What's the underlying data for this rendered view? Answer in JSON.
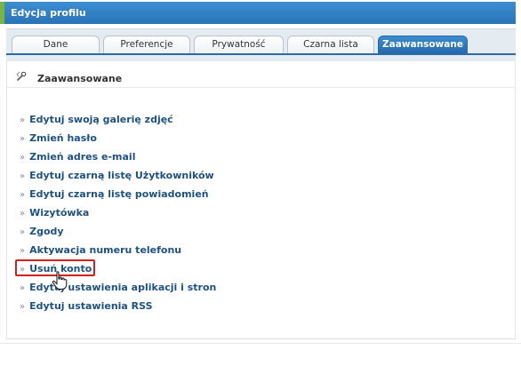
{
  "panel": {
    "title": "Edycja profilu"
  },
  "tabs": [
    {
      "label": "Dane"
    },
    {
      "label": "Preferencje"
    },
    {
      "label": "Prywatność"
    },
    {
      "label": "Czarna lista"
    },
    {
      "label": "Zaawansowane",
      "active": true
    }
  ],
  "section": {
    "title": "Zaawansowane",
    "icon": "wrench-icon"
  },
  "menu": {
    "bullet": "»",
    "items": [
      {
        "label": "Edytuj swoją galerię zdjęć"
      },
      {
        "label": "Zmień hasło"
      },
      {
        "label": "Zmień adres e-mail"
      },
      {
        "label": "Edytuj czarną listę Użytkowników"
      },
      {
        "label": "Edytuj czarną listę powiadomień"
      },
      {
        "label": "Wizytówka"
      },
      {
        "label": "Zgody"
      },
      {
        "label": "Aktywacja numeru telefonu"
      },
      {
        "label": "Usuń konto",
        "highlighted": true
      },
      {
        "label": "Edytuj ustawienia aplikacji i stron"
      },
      {
        "label": "Edytuj ustawienia RSS"
      }
    ]
  },
  "colors": {
    "header": "#2a73b8",
    "header_accent": "#79b63d",
    "link": "#1d5283",
    "highlight_border": "#d02020"
  }
}
